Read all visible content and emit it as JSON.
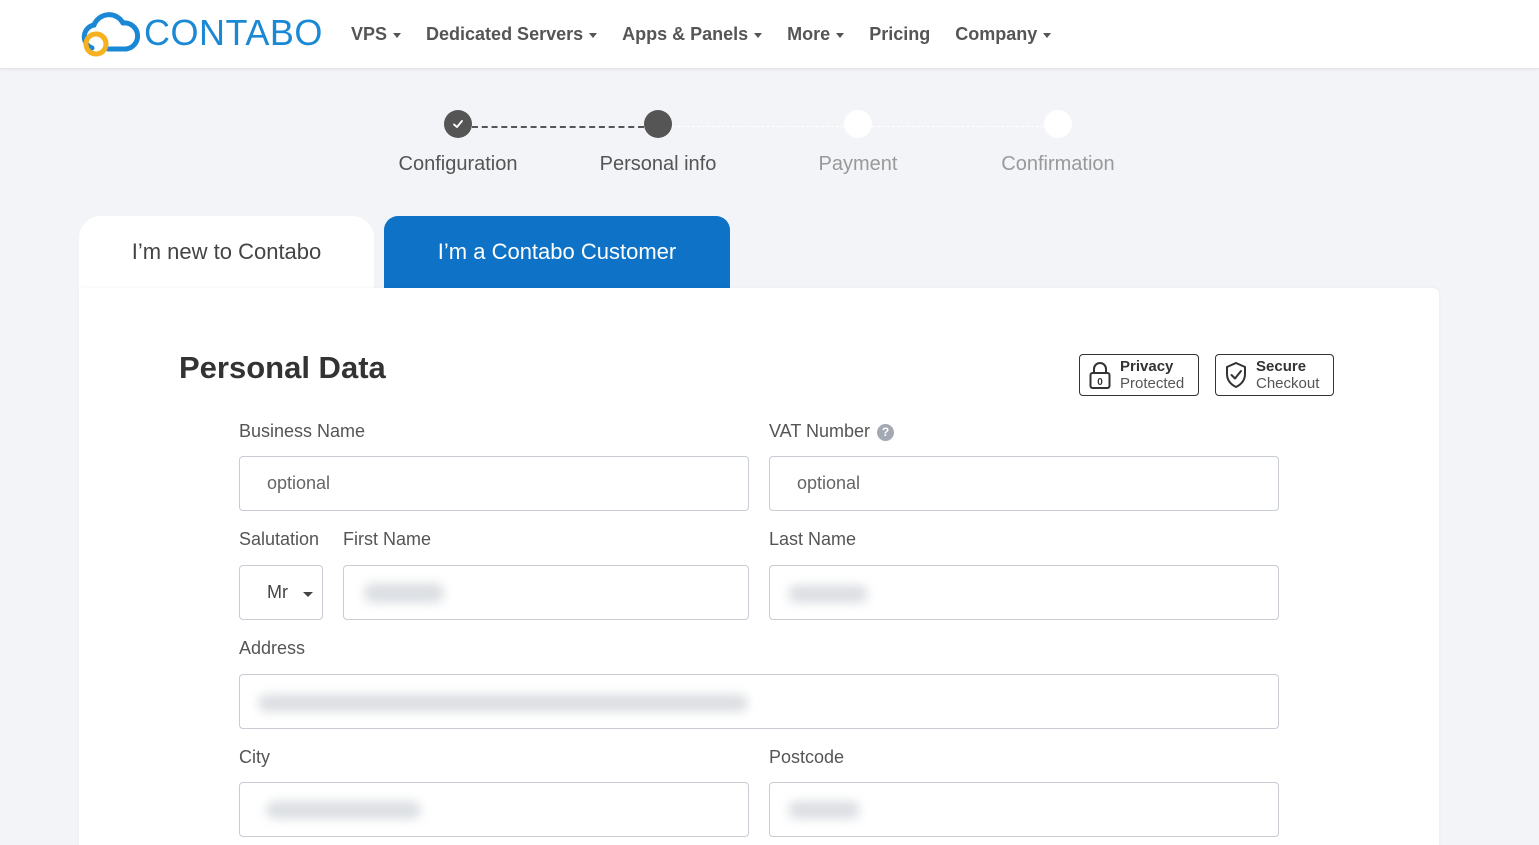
{
  "brand": {
    "name": "CONTABO",
    "color": "#1b88d6"
  },
  "nav": [
    {
      "label": "VPS",
      "dropdown": true
    },
    {
      "label": "Dedicated Servers",
      "dropdown": true
    },
    {
      "label": "Apps & Panels",
      "dropdown": true
    },
    {
      "label": "More",
      "dropdown": true
    },
    {
      "label": "Pricing",
      "dropdown": false
    },
    {
      "label": "Company",
      "dropdown": true
    }
  ],
  "steps": [
    {
      "label": "Configuration",
      "state": "done"
    },
    {
      "label": "Personal info",
      "state": "current"
    },
    {
      "label": "Payment",
      "state": "todo"
    },
    {
      "label": "Confirmation",
      "state": "todo"
    }
  ],
  "tabs": {
    "new_customer": "I’m new to Contabo",
    "existing_customer": "I’m a Contabo Customer"
  },
  "form": {
    "title": "Personal Data",
    "badges": {
      "privacy": {
        "strong": "Privacy",
        "weak": "Protected"
      },
      "secure": {
        "strong": "Secure",
        "weak": "Checkout"
      }
    },
    "business_name": {
      "label": "Business Name",
      "placeholder": "optional"
    },
    "vat_number": {
      "label": "VAT Number",
      "placeholder": "optional",
      "help": "?"
    },
    "salutation": {
      "label": "Salutation",
      "value": "Mr"
    },
    "first_name": {
      "label": "First Name"
    },
    "last_name": {
      "label": "Last Name"
    },
    "address": {
      "label": "Address"
    },
    "city": {
      "label": "City"
    },
    "postcode": {
      "label": "Postcode"
    }
  },
  "colors": {
    "accent": "#0e72c6",
    "stepper_dark": "#555555",
    "background": "#f3f4f8"
  }
}
